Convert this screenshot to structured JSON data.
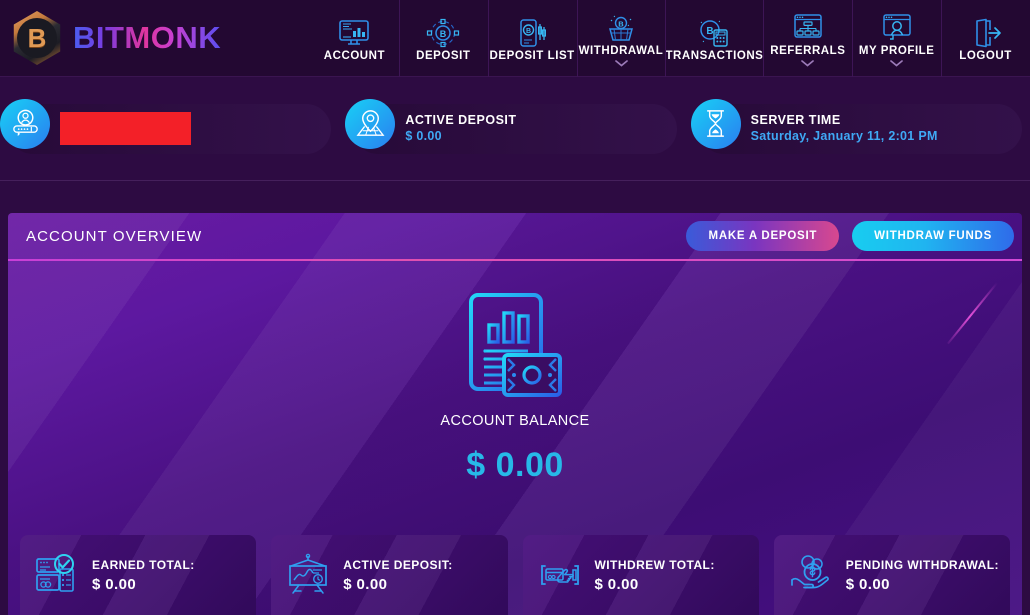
{
  "brand": {
    "initial": "B",
    "name": "BITMONK"
  },
  "nav": {
    "items": [
      {
        "label": "ACCOUNT",
        "icon": "monitor-chart-icon",
        "caret": false
      },
      {
        "label": "DEPOSIT",
        "icon": "bitcoin-network-icon",
        "caret": false
      },
      {
        "label": "DEPOSIT LIST",
        "icon": "mobile-bitcoin-chart-icon",
        "caret": false
      },
      {
        "label": "WITHDRAWAL",
        "icon": "bitcoin-basket-icon",
        "caret": true
      },
      {
        "label": "TRANSACTIONS",
        "icon": "bitcoin-calculator-icon",
        "caret": false
      },
      {
        "label": "REFERRALS",
        "icon": "referral-tree-icon",
        "caret": true
      },
      {
        "label": "MY PROFILE",
        "icon": "profile-browser-icon",
        "caret": true
      },
      {
        "label": "LOGOUT",
        "icon": "logout-door-icon",
        "caret": false
      }
    ]
  },
  "info_strip": {
    "user": {
      "icon": "user-login-icon",
      "username_redacted": ""
    },
    "active_deposit": {
      "icon": "location-pin-icon",
      "title": "ACTIVE DEPOSIT",
      "value": "$ 0.00"
    },
    "server_time": {
      "icon": "hourglass-icon",
      "title": "SERVER TIME",
      "value": "Saturday, January 11, 2:01 PM"
    }
  },
  "panel": {
    "title": "ACCOUNT OVERVIEW",
    "make_deposit_label": "MAKE A DEPOSIT",
    "withdraw_funds_label": "WITHDRAW FUNDS",
    "balance": {
      "icon": "financial-report-icon",
      "label": "ACCOUNT BALANCE",
      "amount": "$ 0.00"
    },
    "stats": [
      {
        "icon": "verified-document-icon",
        "label": "EARNED TOTAL:",
        "value": "$ 0.00"
      },
      {
        "icon": "presentation-chart-icon",
        "label": "ACTIVE DEPOSIT:",
        "value": "$ 0.00"
      },
      {
        "icon": "card-withdraw-icon",
        "label": "WITHDREW TOTAL:",
        "value": "$ 0.00"
      },
      {
        "icon": "hand-coins-icon",
        "label": "PENDING WITHDRAWAL:",
        "value": "$ 0.00"
      }
    ]
  },
  "colors": {
    "accent_cyan": "#27b9e8",
    "accent_pink": "#e050b0",
    "panel_purple": "#5d18a0",
    "topbar": "#230832",
    "redaction": "#f32028"
  }
}
